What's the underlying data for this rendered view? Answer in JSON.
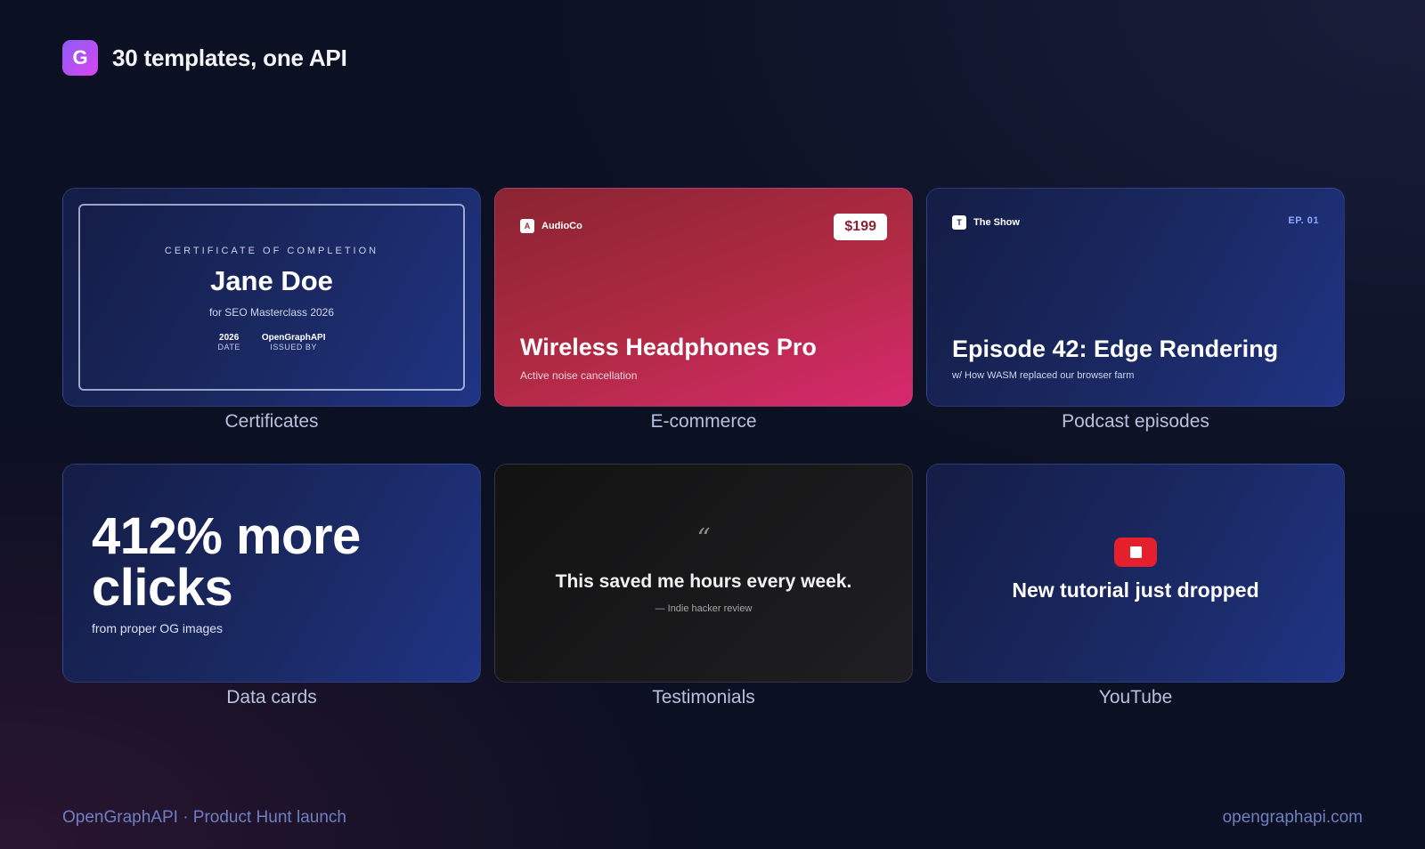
{
  "header": {
    "logo_letter": "G",
    "title": "30 templates, one API"
  },
  "cards": {
    "certificate": {
      "kicker": "CERTIFICATE OF COMPLETION",
      "name": "Jane Doe",
      "subtitle": "for SEO Masterclass 2026",
      "date_value": "2026",
      "date_label": "DATE",
      "issuer_value": "OpenGraphAPI",
      "issuer_label": "ISSUED BY",
      "caption": "Certificates"
    },
    "ecommerce": {
      "brand_mark": "A",
      "brand": "AudioCo",
      "price": "$199",
      "title": "Wireless Headphones Pro",
      "subtitle": "Active noise cancellation",
      "caption": "E-commerce"
    },
    "podcast": {
      "brand_mark": "T",
      "brand": "The Show",
      "episode_tag": "EP. 01",
      "title": "Episode 42: Edge Rendering",
      "subtitle": "w/ How WASM replaced our browser farm",
      "caption": "Podcast episodes"
    },
    "data": {
      "headline_line1": "412% more",
      "headline_line2": "clicks",
      "subtitle": "from proper OG images",
      "caption": "Data cards"
    },
    "testimonial": {
      "quote_mark": "“",
      "quote": "This saved me hours every week.",
      "cite": "— Indie hacker review",
      "caption": "Testimonials"
    },
    "youtube": {
      "title": "New tutorial just dropped",
      "caption": "YouTube"
    }
  },
  "footer": {
    "left": "OpenGraphAPI · Product Hunt launch",
    "right": "opengraphapi.com"
  }
}
